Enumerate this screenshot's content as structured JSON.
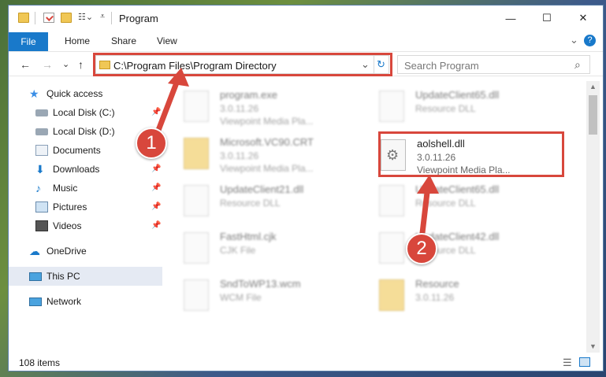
{
  "window": {
    "title": "Program",
    "minimize": "—",
    "maximize": "☐",
    "close": "✕"
  },
  "ribbon": {
    "tabs": [
      "File",
      "Home",
      "Share",
      "View"
    ],
    "help": "?",
    "expand": "⌄"
  },
  "nav": {
    "back": "←",
    "forward": "→",
    "history": "⌄",
    "up": "↑"
  },
  "address": {
    "path": "C:\\Program Files\\Program Directory",
    "dropdown": "⌄",
    "refresh": "↻"
  },
  "search": {
    "placeholder": "Search Program",
    "icon": "⌕"
  },
  "sidebar": {
    "items": [
      {
        "label": "Quick access",
        "icon": "star-icon"
      },
      {
        "label": "Local Disk (C:)",
        "icon": "drive-icon"
      },
      {
        "label": "Local Disk (D:)",
        "icon": "drive-icon"
      },
      {
        "label": "Documents",
        "icon": "documents-icon"
      },
      {
        "label": "Downloads",
        "icon": "download-icon"
      },
      {
        "label": "Music",
        "icon": "music-icon"
      },
      {
        "label": "Pictures",
        "icon": "pictures-icon"
      },
      {
        "label": "Videos",
        "icon": "videos-icon"
      },
      {
        "label": "OneDrive",
        "icon": "cloud-icon"
      },
      {
        "label": "This PC",
        "icon": "computer-icon"
      },
      {
        "label": "Network",
        "icon": "network-icon"
      }
    ]
  },
  "files": [
    {
      "name": "program.exe",
      "line1": "3.0.11.26",
      "line2": "Viewpoint Media Pla..."
    },
    {
      "name": "UpdateClient65.dll",
      "line1": "Resource DLL",
      "line2": ""
    },
    {
      "name": "Microsoft.VC90.CRT",
      "line1": "3.0.11.26",
      "line2": "Viewpoint Media Pla..."
    },
    {
      "name": "aolshell.dll",
      "line1": "3.0.11.26",
      "line2": "Viewpoint Media Pla..."
    },
    {
      "name": "UpdateClient21.dll",
      "line1": "Resource DLL",
      "line2": ""
    },
    {
      "name": "UpdateClient65.dll",
      "line1": "Resource DLL",
      "line2": ""
    },
    {
      "name": "FastHtml.cjk",
      "line1": "CJK File",
      "line2": ""
    },
    {
      "name": "UpdateClient42.dll",
      "line1": "Resource DLL",
      "line2": ""
    },
    {
      "name": "SndToWP13.wcm",
      "line1": "WCM File",
      "line2": ""
    },
    {
      "name": "Resource",
      "line1": "3.0.11.26",
      "line2": ""
    }
  ],
  "status": {
    "count": "108 items"
  },
  "callouts": [
    "1",
    "2"
  ],
  "colors": {
    "accent": "#1979ca",
    "highlight": "#d8473c"
  }
}
